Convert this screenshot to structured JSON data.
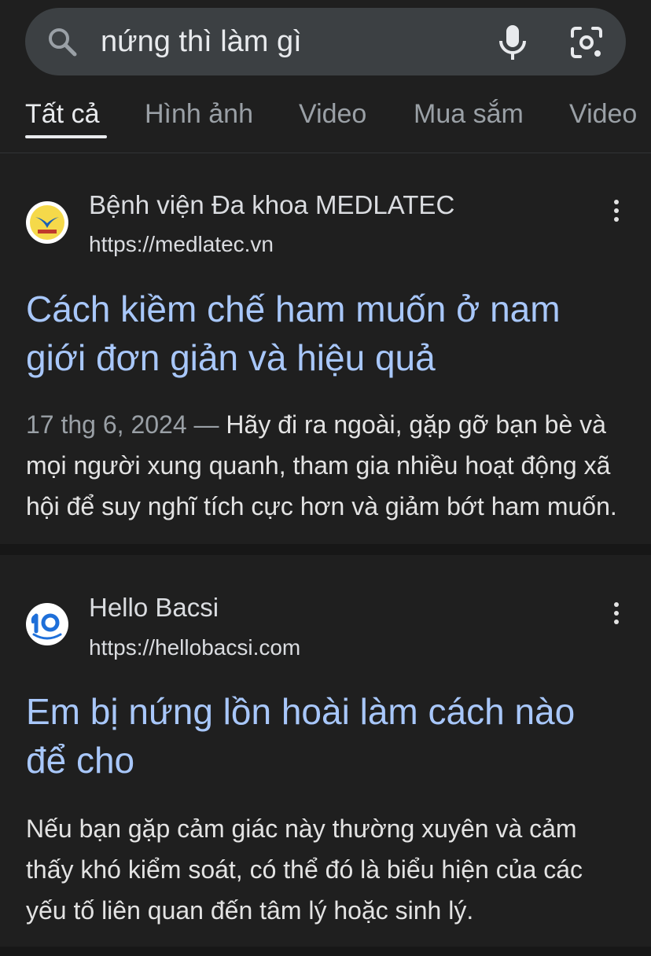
{
  "search": {
    "query": "nứng thì làm gì"
  },
  "tabs": [
    {
      "label": "Tất cả",
      "active": true
    },
    {
      "label": "Hình ảnh",
      "active": false
    },
    {
      "label": "Video",
      "active": false
    },
    {
      "label": "Mua sắm",
      "active": false
    },
    {
      "label": "Video",
      "active": false
    }
  ],
  "results": [
    {
      "site_name": "Bệnh viện Đa khoa MEDLATEC",
      "url": "https://medlatec.vn",
      "title": "Cách kiềm chế ham muốn ở nam giới đơn giản và hiệu quả",
      "date": "17 thg 6, 2024",
      "separator": " — ",
      "snippet": "Hãy đi ra ngoài, gặp gỡ bạn bè và mọi người xung quanh, tham gia nhiều hoạt động xã hội để suy nghĩ tích cực hơn và giảm bớt ham muốn."
    },
    {
      "site_name": "Hello Bacsi",
      "url": "https://hellobacsi.com",
      "title": "Em bị nứng lồn hoài làm cách nào để cho",
      "snippet": "Nếu bạn gặp cảm giác này thường xuyên và cảm thấy khó kiểm soát, có thể đó là biểu hiện của các yếu tố liên quan đến tâm lý hoặc sinh lý."
    }
  ]
}
